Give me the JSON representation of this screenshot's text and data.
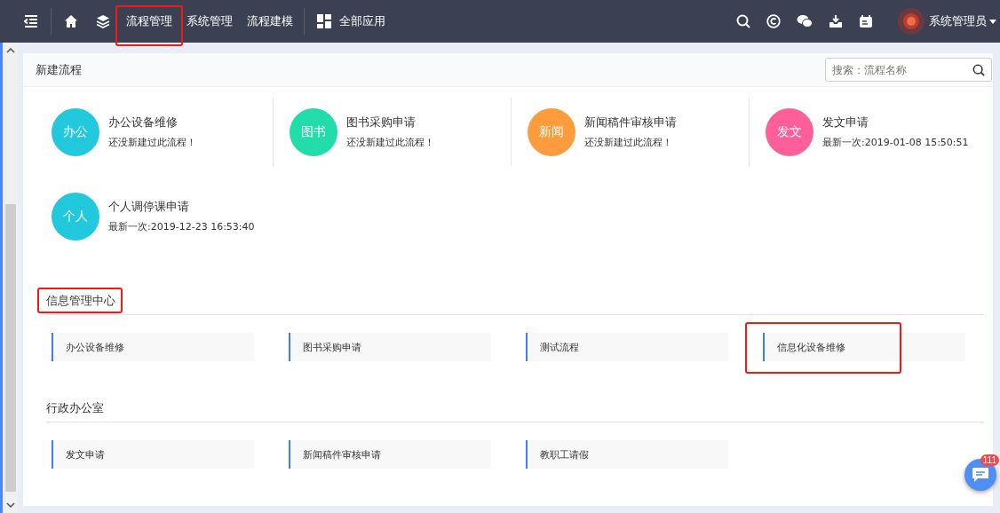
{
  "topbar": {
    "nav": [
      {
        "label": "流程管理",
        "highlighted": true
      },
      {
        "label": "系统管理",
        "highlighted": false
      },
      {
        "label": "流程建模",
        "highlighted": false
      }
    ],
    "apps_label": "全部应用",
    "user": "系统管理员"
  },
  "panel": {
    "title": "新建流程",
    "search": {
      "placeholder": "搜索：流程名称"
    },
    "recent": [
      {
        "badge": "办公",
        "color": "#22c9dc",
        "name": "办公设备维修",
        "note": "还没新建过此流程！"
      },
      {
        "badge": "图书",
        "color": "#22dcaa",
        "name": "图书采购申请",
        "note": "还没新建过此流程！"
      },
      {
        "badge": "新闻",
        "color": "#fd9c3c",
        "name": "新闻稿件审核申请",
        "note": "还没新建过此流程！"
      },
      {
        "badge": "发文",
        "color": "#fd5f9b",
        "name": "发文申请",
        "note": "最新一次:2019-01-08 15:50:51"
      },
      {
        "badge": "个人",
        "color": "#22c9dc",
        "name": "个人调停课申请",
        "note": "最新一次:2019-12-23 16:53:40"
      }
    ]
  },
  "sections": [
    {
      "title": "信息管理中心",
      "highlighted": true,
      "items": [
        {
          "label": "办公设备维修",
          "highlighted": false
        },
        {
          "label": "图书采购申请",
          "highlighted": false
        },
        {
          "label": "测试流程",
          "highlighted": false
        },
        {
          "label": "信息化设备维修",
          "highlighted": true
        }
      ]
    },
    {
      "title": "行政办公室",
      "highlighted": false,
      "items": [
        {
          "label": "发文申请",
          "highlighted": false
        },
        {
          "label": "新闻稿件审核申请",
          "highlighted": false
        },
        {
          "label": "教职工请假",
          "highlighted": false
        }
      ]
    }
  ],
  "chat": {
    "count": "111"
  }
}
